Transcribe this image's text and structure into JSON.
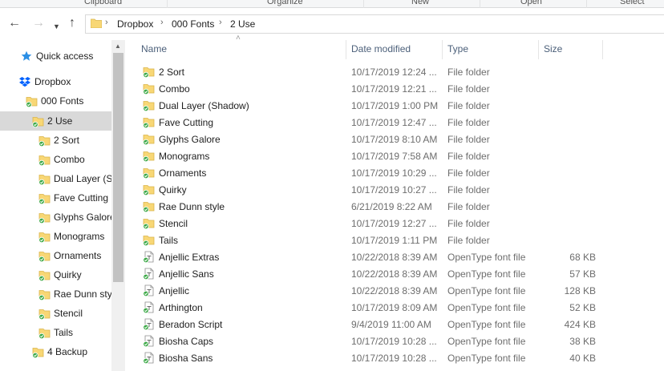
{
  "ribbon": {
    "groups": [
      "Clipboard",
      "Organize",
      "New",
      "Open",
      "Select"
    ]
  },
  "address_bar": {
    "back_icon": "arrow-left-icon",
    "forward_icon": "arrow-right-icon",
    "recent_icon": "chevron-down-icon",
    "up_icon": "arrow-up-icon",
    "breadcrumbs": [
      "Dropbox",
      "000 Fonts",
      "2 Use"
    ]
  },
  "nav_pane": {
    "items": [
      {
        "label": "Quick access",
        "icon": "star-icon",
        "selected": false
      },
      {
        "label": "Dropbox",
        "icon": "dropbox-icon",
        "selected": false
      },
      {
        "label": "000 Fonts",
        "icon": "synced-folder-icon",
        "selected": false
      },
      {
        "label": "2 Use",
        "icon": "synced-folder-icon",
        "selected": true
      },
      {
        "label": "2 Sort",
        "icon": "synced-folder-icon",
        "selected": false
      },
      {
        "label": "Combo",
        "icon": "synced-folder-icon",
        "selected": false
      },
      {
        "label": "Dual Layer (Sh",
        "icon": "synced-folder-icon",
        "selected": false
      },
      {
        "label": "Fave Cutting",
        "icon": "synced-folder-icon",
        "selected": false
      },
      {
        "label": "Glyphs Galore",
        "icon": "synced-folder-icon",
        "selected": false
      },
      {
        "label": "Monograms",
        "icon": "synced-folder-icon",
        "selected": false
      },
      {
        "label": "Ornaments",
        "icon": "synced-folder-icon",
        "selected": false
      },
      {
        "label": "Quirky",
        "icon": "synced-folder-icon",
        "selected": false
      },
      {
        "label": "Rae Dunn sty",
        "icon": "synced-folder-icon",
        "selected": false
      },
      {
        "label": "Stencil",
        "icon": "synced-folder-icon",
        "selected": false
      },
      {
        "label": "Tails",
        "icon": "synced-folder-icon",
        "selected": false
      },
      {
        "label": "4  Backup",
        "icon": "synced-folder-icon",
        "selected": false
      }
    ]
  },
  "file_list": {
    "columns": {
      "name": "Name",
      "date": "Date modified",
      "type": "Type",
      "size": "Size"
    },
    "rows": [
      {
        "name": "2 Sort",
        "date": "10/17/2019 12:24 ...",
        "type": "File folder",
        "size": "",
        "icon": "synced-folder-icon"
      },
      {
        "name": "Combo",
        "date": "10/17/2019 12:21 ...",
        "type": "File folder",
        "size": "",
        "icon": "synced-folder-icon"
      },
      {
        "name": "Dual Layer (Shadow)",
        "date": "10/17/2019 1:00 PM",
        "type": "File folder",
        "size": "",
        "icon": "synced-folder-icon"
      },
      {
        "name": "Fave Cutting",
        "date": "10/17/2019 12:47 ...",
        "type": "File folder",
        "size": "",
        "icon": "synced-folder-icon"
      },
      {
        "name": "Glyphs Galore",
        "date": "10/17/2019 8:10 AM",
        "type": "File folder",
        "size": "",
        "icon": "synced-folder-icon"
      },
      {
        "name": "Monograms",
        "date": "10/17/2019 7:58 AM",
        "type": "File folder",
        "size": "",
        "icon": "synced-folder-icon"
      },
      {
        "name": "Ornaments",
        "date": "10/17/2019 10:29 ...",
        "type": "File folder",
        "size": "",
        "icon": "synced-folder-icon"
      },
      {
        "name": "Quirky",
        "date": "10/17/2019 10:27 ...",
        "type": "File folder",
        "size": "",
        "icon": "synced-folder-icon"
      },
      {
        "name": "Rae Dunn style",
        "date": "6/21/2019 8:22 AM",
        "type": "File folder",
        "size": "",
        "icon": "synced-folder-icon"
      },
      {
        "name": "Stencil",
        "date": "10/17/2019 12:27 ...",
        "type": "File folder",
        "size": "",
        "icon": "synced-folder-icon"
      },
      {
        "name": "Tails",
        "date": "10/17/2019 1:11 PM",
        "type": "File folder",
        "size": "",
        "icon": "synced-folder-icon"
      },
      {
        "name": "Anjellic Extras",
        "date": "10/22/2018 8:39 AM",
        "type": "OpenType font file",
        "size": "68 KB",
        "icon": "synced-font-file-icon"
      },
      {
        "name": "Anjellic Sans",
        "date": "10/22/2018 8:39 AM",
        "type": "OpenType font file",
        "size": "57 KB",
        "icon": "synced-font-file-icon"
      },
      {
        "name": "Anjellic",
        "date": "10/22/2018 8:39 AM",
        "type": "OpenType font file",
        "size": "128 KB",
        "icon": "synced-font-file-icon"
      },
      {
        "name": "Arthington",
        "date": "10/17/2019 8:09 AM",
        "type": "OpenType font file",
        "size": "52 KB",
        "icon": "synced-font-file-icon"
      },
      {
        "name": "Beradon Script",
        "date": "9/4/2019 11:00 AM",
        "type": "OpenType font file",
        "size": "424 KB",
        "icon": "synced-font-file-icon"
      },
      {
        "name": "Biosha Caps",
        "date": "10/17/2019 10:28 ...",
        "type": "OpenType font file",
        "size": "38 KB",
        "icon": "synced-font-file-icon"
      },
      {
        "name": "Biosha Sans",
        "date": "10/17/2019 10:28 ...",
        "type": "OpenType font file",
        "size": "40 KB",
        "icon": "synced-font-file-icon"
      }
    ]
  },
  "colors": {
    "folder": "#f8d775",
    "sync_check": "#3aa845",
    "selected_row": "#d9d9d9",
    "header_text": "#4c607a",
    "dropbox_blue": "#0061fe"
  }
}
